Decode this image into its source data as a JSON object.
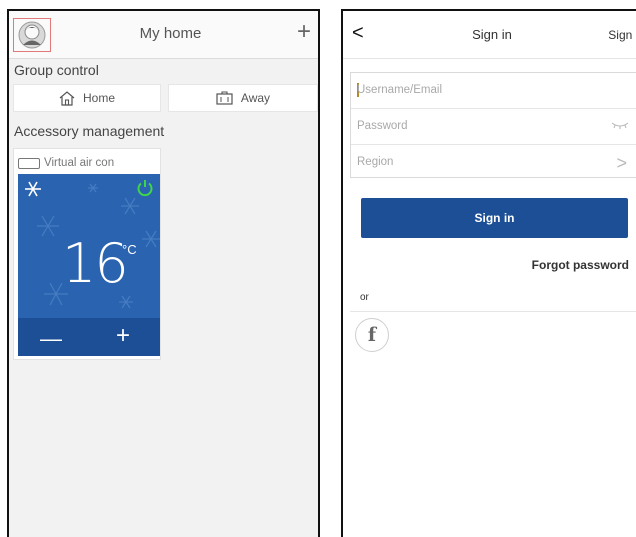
{
  "left": {
    "header": {
      "title": "My home",
      "add_icon": "plus-icon",
      "avatar_icon": "user-avatar-icon"
    },
    "group_control": {
      "label": "Group control",
      "home_label": "Home",
      "away_label": "Away"
    },
    "accessory": {
      "label": "Accessory management",
      "device_name": "Virtual air con",
      "temperature": "16",
      "unit": "°C",
      "mode_icon": "snowflake-icon",
      "power_icon": "power-icon",
      "decrease_symbol": "—",
      "increase_symbol": "+"
    }
  },
  "right": {
    "header": {
      "back": "<",
      "title": "Sign in",
      "signup": "Sign up"
    },
    "form": {
      "username_placeholder": "Username/Email",
      "password_placeholder": "Password",
      "region_placeholder": "Region"
    },
    "signin_button": "Sign in",
    "forgot": "Forgot password",
    "or": "or",
    "facebook": "f"
  },
  "colors": {
    "ac_blue": "#2a64b0",
    "button_blue": "#1c4f95",
    "power_green": "#3fd54a"
  }
}
